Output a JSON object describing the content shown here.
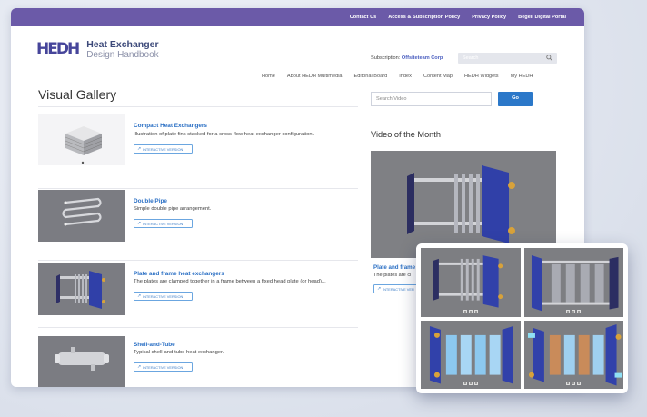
{
  "topbar": {
    "links": [
      "Contact Us",
      "Access & Subscription Policy",
      "Privacy Policy",
      "Begell Digital Portal"
    ]
  },
  "logo": {
    "mark": "HEDH",
    "line1": "Heat Exchanger",
    "line2": "Design Handbook"
  },
  "subscription": {
    "label": "Subscription:",
    "value": "Offsiteteam Corp"
  },
  "search": {
    "placeholder": "Search"
  },
  "nav": [
    "Home",
    "About HEDH Multimedia",
    "Editorial Board",
    "Index",
    "Content Map",
    "HEDH Widgets",
    "My HEDH"
  ],
  "gallery": {
    "title": "Visual Gallery",
    "button_label": "INTERACTIVE VERSION",
    "items": [
      {
        "title": "Compact Heat Exchangers",
        "description": "Illustration of plate fins stacked for a cross-flow heat exchanger configuration."
      },
      {
        "title": "Double Pipe",
        "description": "Simple double pipe arrangement."
      },
      {
        "title": "Plate and frame heat exchangers",
        "description": "The plates are clamped together in a frame between a fixed head plate (or head)..."
      },
      {
        "title": "Shell-and-Tube",
        "description": "Typical shell-and-tube heat exchanger."
      }
    ]
  },
  "sidebar": {
    "search_placeholder": "Search Video",
    "go_label": "Go",
    "video_title": "Video of the Month",
    "video_label": "Plate and frame",
    "video_desc": "The plates are cl",
    "video_button": "INTERACTIVE VER"
  },
  "colors": {
    "topbar": "#6b5aa8",
    "link": "#2a6fc4",
    "button": "#2b78c9",
    "frame_blue": "#2f3fa6"
  }
}
